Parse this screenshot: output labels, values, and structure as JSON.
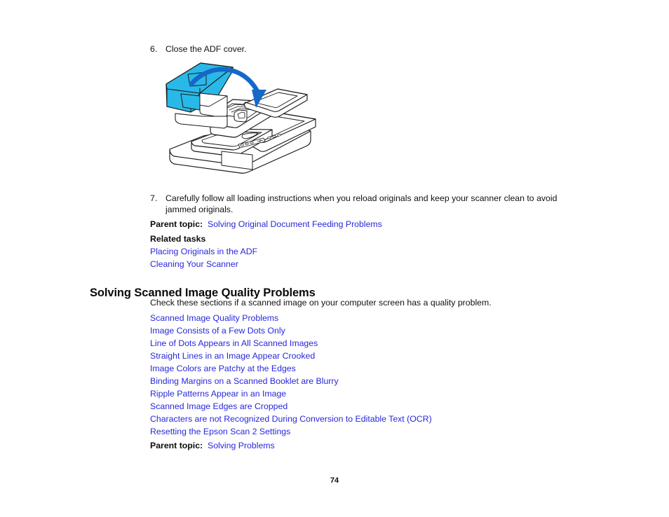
{
  "document": {
    "page_number": "74"
  },
  "steps": [
    {
      "number": "6.",
      "text": "Close the ADF cover."
    },
    {
      "number": "7.",
      "text": "Carefully follow all loading instructions when you reload originals and keep your scanner clean to avoid jammed originals."
    }
  ],
  "figure": {
    "name": "scanner-adf-cover-closing-illustration",
    "highlight_color": "#29b9e8",
    "arrow_color": "#1668c8",
    "outline_color": "#1a1a1a"
  },
  "parent_topic_1": {
    "label": "Parent topic:",
    "link": "Solving Original Document Feeding Problems"
  },
  "related_tasks": {
    "label": "Related tasks",
    "links": [
      "Placing Originals in the ADF",
      "Cleaning Your Scanner"
    ]
  },
  "section": {
    "heading": "Solving Scanned Image Quality Problems",
    "intro": "Check these sections if a scanned image on your computer screen has a quality problem.",
    "topics": [
      "Scanned Image Quality Problems",
      "Image Consists of a Few Dots Only",
      "Line of Dots Appears in All Scanned Images",
      "Straight Lines in an Image Appear Crooked",
      "Image Colors are Patchy at the Edges",
      "Binding Margins on a Scanned Booklet are Blurry",
      "Ripple Patterns Appear in an Image",
      "Scanned Image Edges are Cropped",
      "Characters are not Recognized During Conversion to Editable Text (OCR)",
      "Resetting the Epson Scan 2 Settings"
    ]
  },
  "parent_topic_2": {
    "label": "Parent topic:",
    "link": "Solving Problems"
  },
  "colors": {
    "link": "#2727dd",
    "text": "#111111",
    "highlight": "#29b9e8",
    "arrow": "#1668c8"
  }
}
